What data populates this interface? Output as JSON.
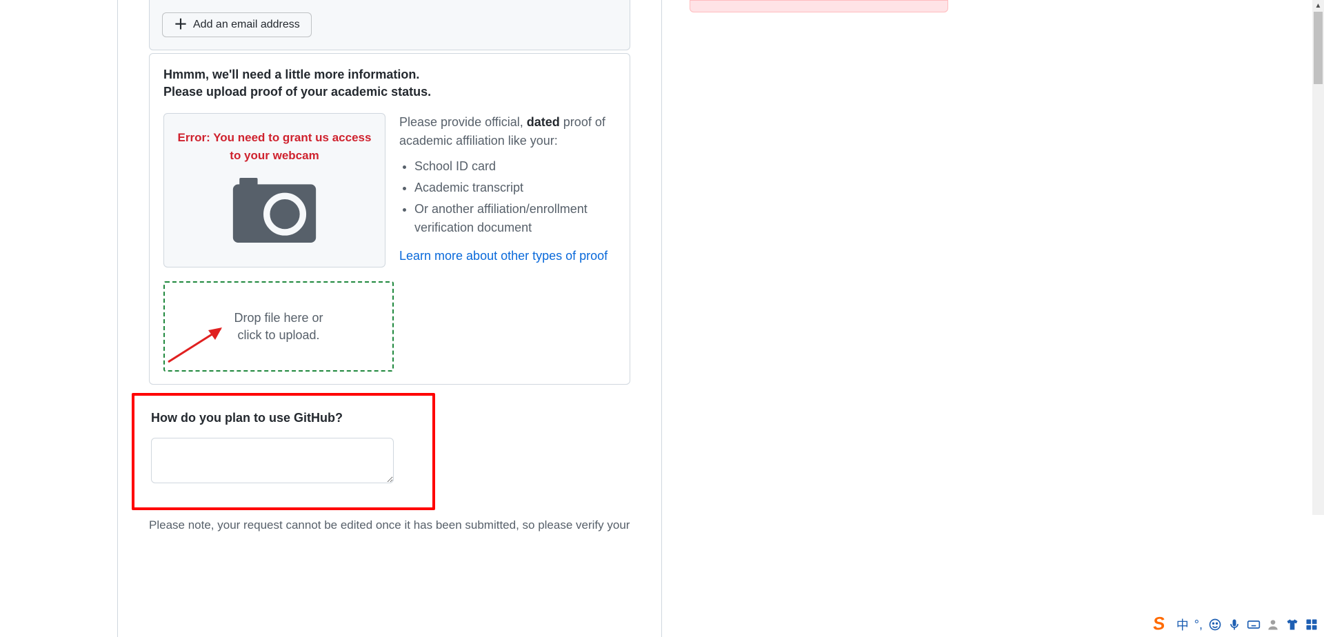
{
  "email_section": {
    "add_button_label": "Add an email address"
  },
  "proof": {
    "heading_line1": "Hmmm, we'll need a little more information.",
    "heading_line2": "Please upload proof of your academic status.",
    "camera_error": "Error: You need to grant us access to your webcam",
    "info_prefix": "Please provide official, ",
    "info_dated": "dated",
    "info_suffix": " proof of academic affiliation like your:",
    "list": [
      "School ID card",
      "Academic transcript",
      "Or another affiliation/enrollment verification document"
    ],
    "learn_more": "Learn more about other types of proof",
    "dropzone_line1": "Drop file here or",
    "dropzone_line2": "click to upload."
  },
  "question": {
    "label": "How do you plan to use GitHub?",
    "value": ""
  },
  "footnote": "Please note, your request cannot be edited once it has been submitted, so please verify your",
  "ime": {
    "logo_letter": "S",
    "cn": "中"
  }
}
